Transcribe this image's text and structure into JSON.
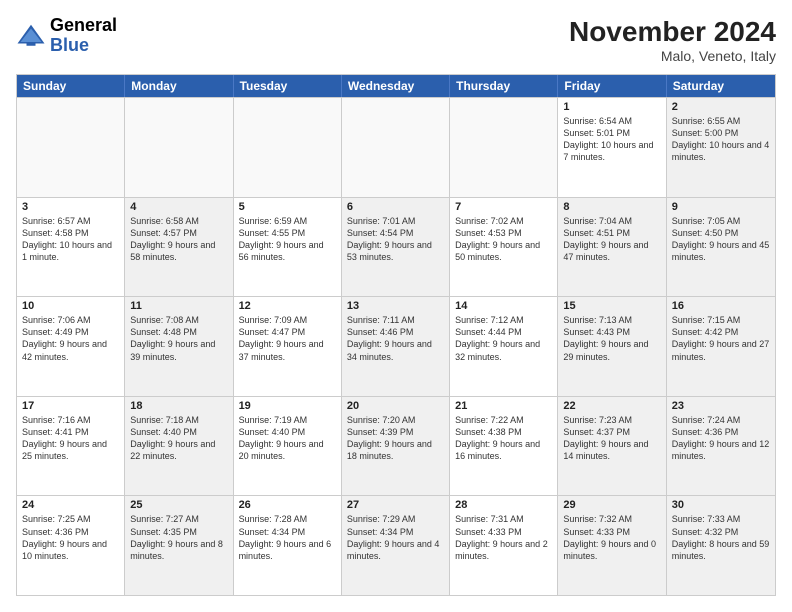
{
  "logo": {
    "general": "General",
    "blue": "Blue"
  },
  "header": {
    "month": "November 2024",
    "location": "Malo, Veneto, Italy"
  },
  "calendar": {
    "days": [
      "Sunday",
      "Monday",
      "Tuesday",
      "Wednesday",
      "Thursday",
      "Friday",
      "Saturday"
    ],
    "rows": [
      [
        {
          "day": "",
          "info": "",
          "empty": true
        },
        {
          "day": "",
          "info": "",
          "empty": true
        },
        {
          "day": "",
          "info": "",
          "empty": true
        },
        {
          "day": "",
          "info": "",
          "empty": true
        },
        {
          "day": "",
          "info": "",
          "empty": true
        },
        {
          "day": "1",
          "info": "Sunrise: 6:54 AM\nSunset: 5:01 PM\nDaylight: 10 hours and 7 minutes."
        },
        {
          "day": "2",
          "info": "Sunrise: 6:55 AM\nSunset: 5:00 PM\nDaylight: 10 hours and 4 minutes.",
          "shaded": true
        }
      ],
      [
        {
          "day": "3",
          "info": "Sunrise: 6:57 AM\nSunset: 4:58 PM\nDaylight: 10 hours and 1 minute."
        },
        {
          "day": "4",
          "info": "Sunrise: 6:58 AM\nSunset: 4:57 PM\nDaylight: 9 hours and 58 minutes.",
          "shaded": true
        },
        {
          "day": "5",
          "info": "Sunrise: 6:59 AM\nSunset: 4:55 PM\nDaylight: 9 hours and 56 minutes."
        },
        {
          "day": "6",
          "info": "Sunrise: 7:01 AM\nSunset: 4:54 PM\nDaylight: 9 hours and 53 minutes.",
          "shaded": true
        },
        {
          "day": "7",
          "info": "Sunrise: 7:02 AM\nSunset: 4:53 PM\nDaylight: 9 hours and 50 minutes."
        },
        {
          "day": "8",
          "info": "Sunrise: 7:04 AM\nSunset: 4:51 PM\nDaylight: 9 hours and 47 minutes.",
          "shaded": true
        },
        {
          "day": "9",
          "info": "Sunrise: 7:05 AM\nSunset: 4:50 PM\nDaylight: 9 hours and 45 minutes.",
          "shaded": true
        }
      ],
      [
        {
          "day": "10",
          "info": "Sunrise: 7:06 AM\nSunset: 4:49 PM\nDaylight: 9 hours and 42 minutes."
        },
        {
          "day": "11",
          "info": "Sunrise: 7:08 AM\nSunset: 4:48 PM\nDaylight: 9 hours and 39 minutes.",
          "shaded": true
        },
        {
          "day": "12",
          "info": "Sunrise: 7:09 AM\nSunset: 4:47 PM\nDaylight: 9 hours and 37 minutes."
        },
        {
          "day": "13",
          "info": "Sunrise: 7:11 AM\nSunset: 4:46 PM\nDaylight: 9 hours and 34 minutes.",
          "shaded": true
        },
        {
          "day": "14",
          "info": "Sunrise: 7:12 AM\nSunset: 4:44 PM\nDaylight: 9 hours and 32 minutes."
        },
        {
          "day": "15",
          "info": "Sunrise: 7:13 AM\nSunset: 4:43 PM\nDaylight: 9 hours and 29 minutes.",
          "shaded": true
        },
        {
          "day": "16",
          "info": "Sunrise: 7:15 AM\nSunset: 4:42 PM\nDaylight: 9 hours and 27 minutes.",
          "shaded": true
        }
      ],
      [
        {
          "day": "17",
          "info": "Sunrise: 7:16 AM\nSunset: 4:41 PM\nDaylight: 9 hours and 25 minutes."
        },
        {
          "day": "18",
          "info": "Sunrise: 7:18 AM\nSunset: 4:40 PM\nDaylight: 9 hours and 22 minutes.",
          "shaded": true
        },
        {
          "day": "19",
          "info": "Sunrise: 7:19 AM\nSunset: 4:40 PM\nDaylight: 9 hours and 20 minutes."
        },
        {
          "day": "20",
          "info": "Sunrise: 7:20 AM\nSunset: 4:39 PM\nDaylight: 9 hours and 18 minutes.",
          "shaded": true
        },
        {
          "day": "21",
          "info": "Sunrise: 7:22 AM\nSunset: 4:38 PM\nDaylight: 9 hours and 16 minutes."
        },
        {
          "day": "22",
          "info": "Sunrise: 7:23 AM\nSunset: 4:37 PM\nDaylight: 9 hours and 14 minutes.",
          "shaded": true
        },
        {
          "day": "23",
          "info": "Sunrise: 7:24 AM\nSunset: 4:36 PM\nDaylight: 9 hours and 12 minutes.",
          "shaded": true
        }
      ],
      [
        {
          "day": "24",
          "info": "Sunrise: 7:25 AM\nSunset: 4:36 PM\nDaylight: 9 hours and 10 minutes."
        },
        {
          "day": "25",
          "info": "Sunrise: 7:27 AM\nSunset: 4:35 PM\nDaylight: 9 hours and 8 minutes.",
          "shaded": true
        },
        {
          "day": "26",
          "info": "Sunrise: 7:28 AM\nSunset: 4:34 PM\nDaylight: 9 hours and 6 minutes."
        },
        {
          "day": "27",
          "info": "Sunrise: 7:29 AM\nSunset: 4:34 PM\nDaylight: 9 hours and 4 minutes.",
          "shaded": true
        },
        {
          "day": "28",
          "info": "Sunrise: 7:31 AM\nSunset: 4:33 PM\nDaylight: 9 hours and 2 minutes."
        },
        {
          "day": "29",
          "info": "Sunrise: 7:32 AM\nSunset: 4:33 PM\nDaylight: 9 hours and 0 minutes.",
          "shaded": true
        },
        {
          "day": "30",
          "info": "Sunrise: 7:33 AM\nSunset: 4:32 PM\nDaylight: 8 hours and 59 minutes.",
          "shaded": true
        }
      ]
    ]
  }
}
